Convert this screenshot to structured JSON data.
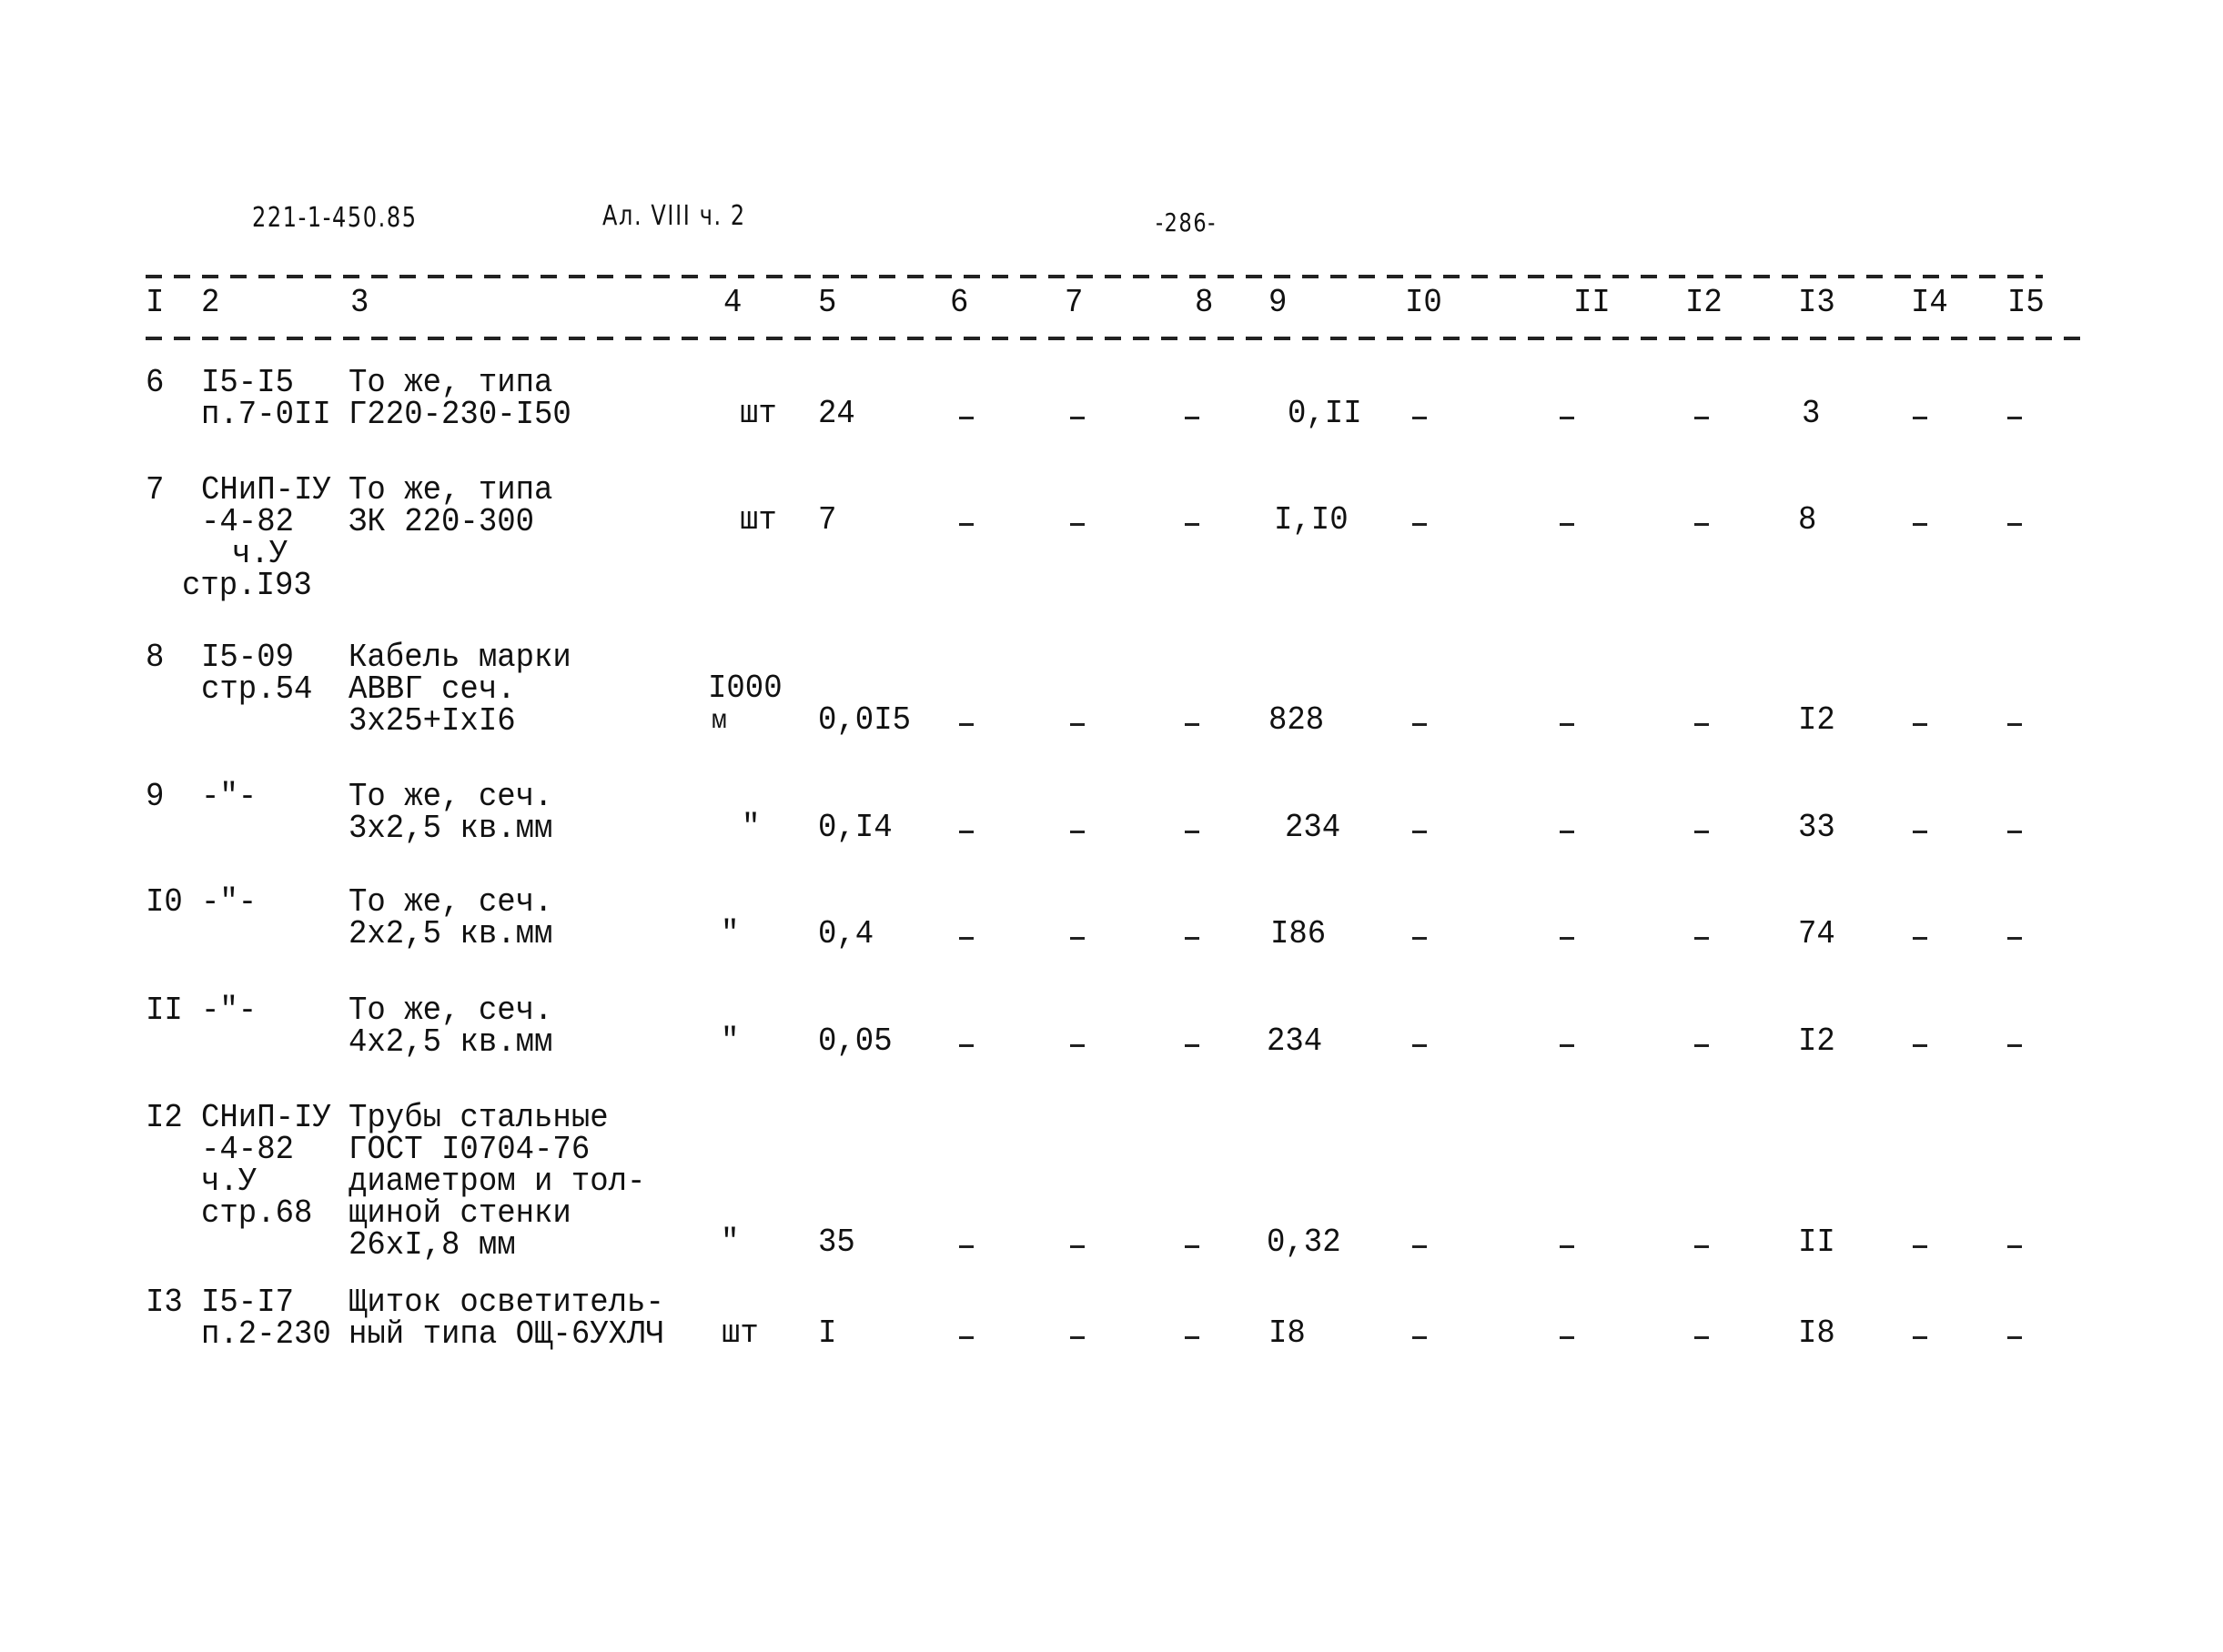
{
  "header": {
    "doc_code": "221-1-450.85",
    "album": "Ал. VIII ч. 2",
    "page_number": "-286-"
  },
  "table": {
    "column_numbers": [
      "I",
      "2",
      "3",
      "4",
      "5",
      "6",
      "7",
      "8",
      "9",
      "I0",
      "II",
      "I2",
      "I3",
      "I4",
      "I5"
    ],
    "rows": [
      {
        "no": "6",
        "ref": [
          "I5-I5",
          "п.7-0II"
        ],
        "name": [
          "То же, типа",
          "Г220-230-I50"
        ],
        "unit": [
          "шт"
        ],
        "c5": "24",
        "c6": "-",
        "c7": "-",
        "c8": "-",
        "c9": "0,II",
        "c10": "-",
        "c11": "-",
        "c12": "-",
        "c13": "3",
        "c14": "-",
        "c15": "-"
      },
      {
        "no": "7",
        "ref": [
          "СНиП-IУ",
          "-4-82",
          "ч.У",
          "стр.I93"
        ],
        "name": [
          "То же, типа",
          "ЗК 220-300"
        ],
        "unit": [
          "шт"
        ],
        "c5": "7",
        "c6": "-",
        "c7": "-",
        "c8": "-",
        "c9": "I,I0",
        "c10": "-",
        "c11": "-",
        "c12": "-",
        "c13": "8",
        "c14": "-",
        "c15": "-"
      },
      {
        "no": "8",
        "ref": [
          "I5-09",
          "стр.54"
        ],
        "name": [
          "Кабель марки",
          "АВВГ сеч.",
          "3х25+IхI6"
        ],
        "unit": [
          "I000",
          "м"
        ],
        "c5": "0,0I5",
        "c6": "-",
        "c7": "-",
        "c8": "-",
        "c9": "828",
        "c10": "-",
        "c11": "-",
        "c12": "-",
        "c13": "I2",
        "c14": "-",
        "c15": "-"
      },
      {
        "no": "9",
        "ref": [
          "-\"-"
        ],
        "name": [
          "То же, сеч.",
          "3х2,5 кв.мм"
        ],
        "unit": [
          "\""
        ],
        "c5": "0,I4",
        "c6": "-",
        "c7": "-",
        "c8": "-",
        "c9": "234",
        "c10": "-",
        "c11": "-",
        "c12": "-",
        "c13": "33",
        "c14": "-",
        "c15": "-"
      },
      {
        "no": "I0",
        "ref": [
          "-\"-"
        ],
        "name": [
          "То же, сеч.",
          "2х2,5 кв.мм"
        ],
        "unit": [
          "\""
        ],
        "c5": "0,4",
        "c6": "-",
        "c7": "-",
        "c8": "-",
        "c9": "I86",
        "c10": "-",
        "c11": "-",
        "c12": "-",
        "c13": "74",
        "c14": "-",
        "c15": "-"
      },
      {
        "no": "II",
        "ref": [
          "-\"-"
        ],
        "name": [
          "То же, сеч.",
          "4х2,5 кв.мм"
        ],
        "unit": [
          "\""
        ],
        "c5": "0,05",
        "c6": "-",
        "c7": "-",
        "c8": "-",
        "c9": "234",
        "c10": "-",
        "c11": "-",
        "c12": "-",
        "c13": "I2",
        "c14": "-",
        "c15": "-"
      },
      {
        "no": "I2",
        "ref": [
          "СНиП-IУ",
          "-4-82",
          "ч.У",
          "стр.68"
        ],
        "name": [
          "Трубы стальные",
          "ГОСТ I0704-76",
          "диаметром и тол-",
          "щиной стенки",
          "26хI,8 мм"
        ],
        "unit": [
          "\""
        ],
        "c5": "35",
        "c6": "-",
        "c7": "-",
        "c8": "-",
        "c9": "0,32",
        "c10": "-",
        "c11": "-",
        "c12": "-",
        "c13": "II",
        "c14": "-",
        "c15": "-"
      },
      {
        "no": "I3",
        "ref": [
          "I5-I7",
          "п.2-230"
        ],
        "name": [
          "Щиток осветитель-",
          "ный типа ОЩ-6УХЛЧ"
        ],
        "unit": [
          "шт"
        ],
        "c5": "I",
        "c6": "-",
        "c7": "-",
        "c8": "-",
        "c9": "I8",
        "c10": "-",
        "c11": "-",
        "c12": "-",
        "c13": "I8",
        "c14": "-",
        "c15": "-"
      }
    ]
  }
}
